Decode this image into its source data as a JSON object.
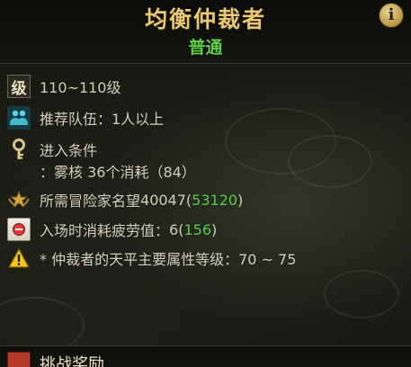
{
  "header": {
    "title": "均衡仲裁者",
    "difficulty": "普通",
    "info_icon": "info-icon",
    "info_glyph": "i"
  },
  "details": {
    "level": {
      "icon": "level-icon",
      "icon_glyph": "级",
      "text": "110~110级"
    },
    "party": {
      "icon": "team-icon",
      "text": "推荐队伍：1人以上"
    },
    "entry": {
      "icon": "key-icon",
      "text": "进入条件",
      "requirement": "：雾核 36个消耗（84）"
    },
    "fame": {
      "icon": "fame-icon",
      "label": "所需冒险家名望 ",
      "required": "40047",
      "current_open": "(",
      "current": "53120",
      "current_close": ")"
    },
    "fatigue": {
      "icon": "fatigue-icon",
      "label": "入场时消耗疲劳值：",
      "required": "6",
      "current_open": "(",
      "current": "156",
      "current_close": ")"
    },
    "warning": {
      "icon": "warning-icon",
      "text": "* 仲裁者的天平主要属性等级：70 ~ 75"
    }
  },
  "reward": {
    "icon": "reward-icon",
    "label": "挑战奖励"
  },
  "colors": {
    "title_gold": "#e7c873",
    "accent_green": "#59c94b",
    "text": "#d2cdb8"
  }
}
